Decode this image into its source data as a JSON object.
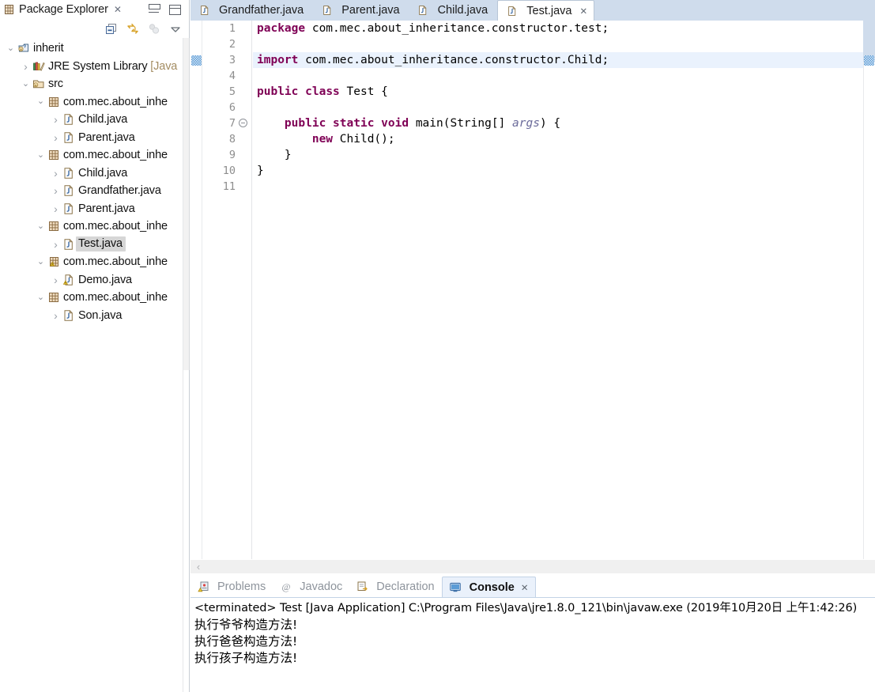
{
  "explorer": {
    "tab_title": "Package Explorer",
    "close_glyph": "✕",
    "toolbar": [
      {
        "name": "collapse-all-icon",
        "tooltip": "Collapse All"
      },
      {
        "name": "link-with-editor-icon",
        "tooltip": "Link with Editor"
      },
      {
        "name": "focus-on-active-task-icon",
        "tooltip": "Focus on Active Task"
      },
      {
        "name": "view-menu-icon",
        "tooltip": "View Menu"
      }
    ],
    "tree": [
      {
        "label": "inherit",
        "icon": "java-project-icon",
        "indent": 0,
        "arrow": "v",
        "selected": false
      },
      {
        "label": "JRE System Library ",
        "dim": "[Java",
        "icon": "library-icon",
        "indent": 1,
        "arrow": ">",
        "selected": false
      },
      {
        "label": "src",
        "icon": "source-folder-icon",
        "indent": 1,
        "arrow": "v",
        "selected": false
      },
      {
        "label": "com.mec.about_inhe",
        "icon": "package-icon",
        "indent": 2,
        "arrow": "v",
        "selected": false
      },
      {
        "label": "Child.java",
        "icon": "java-file-icon",
        "indent": 3,
        "arrow": ">",
        "selected": false
      },
      {
        "label": "Parent.java",
        "icon": "java-file-icon",
        "indent": 3,
        "arrow": ">",
        "selected": false
      },
      {
        "label": "com.mec.about_inhe",
        "icon": "package-icon",
        "indent": 2,
        "arrow": "v",
        "selected": false
      },
      {
        "label": "Child.java",
        "icon": "java-file-icon",
        "indent": 3,
        "arrow": ">",
        "selected": false
      },
      {
        "label": "Grandfather.java",
        "icon": "java-file-icon",
        "indent": 3,
        "arrow": ">",
        "selected": false
      },
      {
        "label": "Parent.java",
        "icon": "java-file-icon",
        "indent": 3,
        "arrow": ">",
        "selected": false
      },
      {
        "label": "com.mec.about_inhe",
        "icon": "package-icon",
        "indent": 2,
        "arrow": "v",
        "selected": false
      },
      {
        "label": "Test.java",
        "icon": "java-file-icon",
        "indent": 3,
        "arrow": ">",
        "selected": true
      },
      {
        "label": "com.mec.about_inhe",
        "icon": "package-warning-icon",
        "indent": 2,
        "arrow": "v",
        "selected": false
      },
      {
        "label": "Demo.java",
        "icon": "java-file-warning-icon",
        "indent": 3,
        "arrow": ">",
        "selected": false
      },
      {
        "label": "com.mec.about_inhe",
        "icon": "package-icon",
        "indent": 2,
        "arrow": "v",
        "selected": false
      },
      {
        "label": "Son.java",
        "icon": "java-file-icon",
        "indent": 3,
        "arrow": ">",
        "selected": false
      }
    ]
  },
  "editor": {
    "tabs": [
      {
        "label": "Grandfather.java",
        "active": false,
        "closable": false
      },
      {
        "label": "Parent.java",
        "active": false,
        "closable": false
      },
      {
        "label": "Child.java",
        "active": false,
        "closable": false
      },
      {
        "label": "Test.java",
        "active": true,
        "closable": true
      }
    ],
    "close_glyph": "✕",
    "scroll_left_glyph": "‹",
    "line_numbers": [
      "1",
      "2",
      "3",
      "4",
      "5",
      "6",
      "7",
      "8",
      "9",
      "10",
      "11"
    ],
    "highlight_line": 3,
    "fold_line": 7,
    "lines": [
      [
        {
          "t": "package",
          "c": "kw"
        },
        {
          "t": " com.mec.about_inheritance.constructor.test;",
          "c": ""
        }
      ],
      [
        {
          "t": "",
          "c": ""
        }
      ],
      [
        {
          "t": "import",
          "c": "kw"
        },
        {
          "t": " com.mec.about_inheritance.constructor.Child;",
          "c": ""
        }
      ],
      [
        {
          "t": "",
          "c": ""
        }
      ],
      [
        {
          "t": "public",
          "c": "kw"
        },
        {
          "t": " ",
          "c": ""
        },
        {
          "t": "class",
          "c": "kw"
        },
        {
          "t": " Test {",
          "c": ""
        }
      ],
      [
        {
          "t": "",
          "c": ""
        }
      ],
      [
        {
          "t": "    ",
          "c": ""
        },
        {
          "t": "public",
          "c": "kw"
        },
        {
          "t": " ",
          "c": ""
        },
        {
          "t": "static",
          "c": "kw"
        },
        {
          "t": " ",
          "c": ""
        },
        {
          "t": "void",
          "c": "kw"
        },
        {
          "t": " main(String[] ",
          "c": ""
        },
        {
          "t": "args",
          "c": "par"
        },
        {
          "t": ") {",
          "c": ""
        }
      ],
      [
        {
          "t": "        ",
          "c": ""
        },
        {
          "t": "new",
          "c": "kw"
        },
        {
          "t": " Child();",
          "c": ""
        }
      ],
      [
        {
          "t": "    }",
          "c": ""
        }
      ],
      [
        {
          "t": "}",
          "c": ""
        }
      ],
      [
        {
          "t": "",
          "c": ""
        }
      ]
    ]
  },
  "bottom": {
    "tabs": [
      {
        "label": "Problems",
        "icon": "problems-icon",
        "active": false,
        "closable": false
      },
      {
        "label": "Javadoc",
        "icon": "javadoc-icon",
        "active": false,
        "closable": false
      },
      {
        "label": "Declaration",
        "icon": "declaration-icon",
        "active": false,
        "closable": false
      },
      {
        "label": "Console",
        "icon": "console-icon",
        "active": true,
        "closable": true
      }
    ],
    "close_glyph": "✕",
    "console_lines": [
      {
        "text": "<terminated> Test [Java Application] C:\\Program Files\\Java\\jre1.8.0_121\\bin\\javaw.exe (2019年10月20日 上午1:42:26)",
        "cjk": false
      },
      {
        "text": "执行爷爷构造方法!",
        "cjk": true
      },
      {
        "text": "执行爸爸构造方法!",
        "cjk": true
      },
      {
        "text": "执行孩子构造方法!",
        "cjk": true
      }
    ]
  },
  "colors": {
    "keyword": "#7F0055",
    "parameter": "#6A6A9A",
    "tab_bar": "#CFDCEC",
    "current_line": "#EAF2FD",
    "selection": "#D6D6D6",
    "console_active_tab": "#EAF1FB"
  }
}
